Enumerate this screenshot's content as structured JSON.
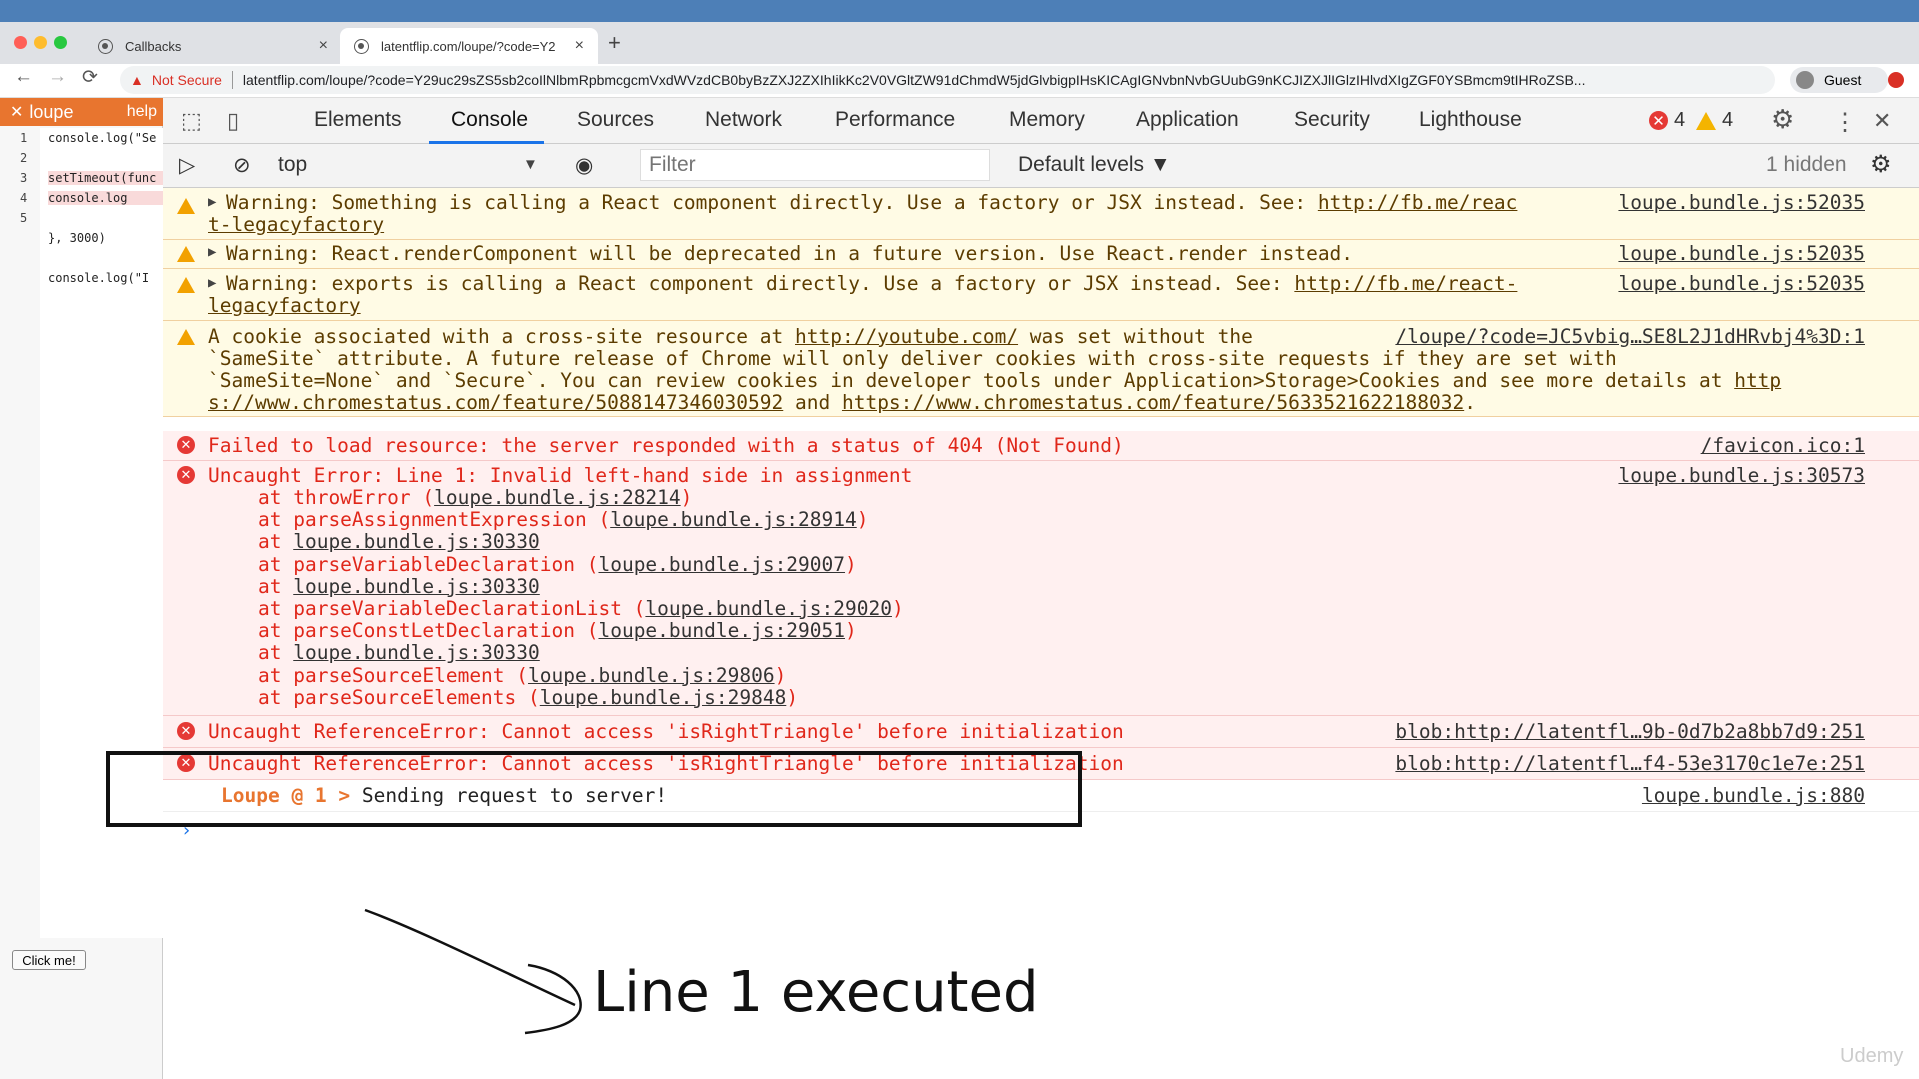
{
  "browser": {
    "tabs": [
      {
        "title": "Callbacks",
        "close": "×"
      },
      {
        "title": "latentflip.com/loupe/?code=Y2",
        "close": "×"
      }
    ],
    "new_tab": "+",
    "nav": {
      "back": "←",
      "forward": "→",
      "reload": "⟳"
    },
    "security_warning": "Not Secure",
    "url": "latentflip.com/loupe/?code=Y29uc29sZS5sb2coIlNlbmRpbmcgcmVxdWVzdCB0byBzZXJ2ZXIhIikKc2V0VGltZW91dChmdW5jdGlvbigpIHsKICAgIGNvbnNvbGUubG9nKCJIZXJlIGlzIHlvdXIgZGF0YSBmcm9tIHRoZSB...",
    "profile": "Guest"
  },
  "loupe": {
    "title": "loupe",
    "help": "help",
    "code_lines": [
      {
        "num": "1",
        "text": "console.log(\"Se"
      },
      {
        "num": "2",
        "text": ""
      },
      {
        "num": "3",
        "text": "setTimeout(func"
      },
      {
        "num": "4",
        "text": "    console.log"
      },
      {
        "num": "5",
        "text": ""
      },
      {
        "num": "",
        "text": "}, 3000)"
      },
      {
        "num": "",
        "text": ""
      },
      {
        "num": "",
        "text": "console.log(\"I"
      }
    ],
    "click_button": "Click me!"
  },
  "devtools": {
    "tabs": [
      "Elements",
      "Console",
      "Sources",
      "Network",
      "Performance",
      "Memory",
      "Application",
      "Security",
      "Lighthouse"
    ],
    "active_tab": "Console",
    "error_count": "4",
    "warning_count": "4",
    "close": "✕",
    "context": "top",
    "filter_placeholder": "Filter",
    "levels": "Default levels ▼",
    "hidden": "1 hidden"
  },
  "console": {
    "messages": [
      {
        "type": "warning",
        "line1": "Warning: Something is calling a React component directly. Use a factory or JSX instead. See: ",
        "link1": "http://fb.me/reac",
        "line2": "t-legacyfactory",
        "source": "loupe.bundle.js:52035"
      },
      {
        "type": "warning",
        "line1": "Warning: React.renderComponent will be deprecated in a future version. Use React.render instead.",
        "source": "loupe.bundle.js:52035"
      },
      {
        "type": "warning",
        "line1": "Warning: exports is calling a React component directly. Use a factory or JSX instead. See: ",
        "link1": "http://fb.me/react-",
        "line2": "legacyfactory",
        "source": "loupe.bundle.js:52035"
      },
      {
        "type": "warning",
        "line1a": "A cookie associated with a cross-site resource at ",
        "link1": "http://youtube.com/",
        "line1b": " was set without the",
        "line2": "`SameSite` attribute. A future release of Chrome will only deliver cookies with cross-site requests if they are set with",
        "line3a": "`SameSite=None` and `Secure`. You can review cookies in developer tools under Application>Storage>Cookies and see more details at ",
        "link3": "http",
        "line4a": "s://www.chromestatus.com/feature/5088147346030592",
        "line4b": " and ",
        "line4c": "https://www.chromestatus.com/feature/5633521622188032",
        "line4d": ".",
        "source": "/loupe/?code=JC5vbig…SE8L2J1dHRvbj4%3D:1"
      },
      {
        "type": "error",
        "line1": "Failed to load resource: the server responded with a status of 404 (Not Found)",
        "source": "/favicon.ico:1"
      },
      {
        "type": "error",
        "line1": "Uncaught Error: Line 1: Invalid left-hand side in assignment",
        "source": "loupe.bundle.js:30573",
        "stack": [
          {
            "fn": "at throwError (",
            "loc": "loupe.bundle.js:28214",
            "end": ")"
          },
          {
            "fn": "at parseAssignmentExpression (",
            "loc": "loupe.bundle.js:28914",
            "end": ")"
          },
          {
            "fn": "at ",
            "loc": "loupe.bundle.js:30330",
            "end": ""
          },
          {
            "fn": "at parseVariableDeclaration (",
            "loc": "loupe.bundle.js:29007",
            "end": ")"
          },
          {
            "fn": "at ",
            "loc": "loupe.bundle.js:30330",
            "end": ""
          },
          {
            "fn": "at parseVariableDeclarationList (",
            "loc": "loupe.bundle.js:29020",
            "end": ")"
          },
          {
            "fn": "at parseConstLetDeclaration (",
            "loc": "loupe.bundle.js:29051",
            "end": ")"
          },
          {
            "fn": "at ",
            "loc": "loupe.bundle.js:30330",
            "end": ""
          },
          {
            "fn": "at parseSourceElement (",
            "loc": "loupe.bundle.js:29806",
            "end": ")"
          },
          {
            "fn": "at parseSourceElements (",
            "loc": "loupe.bundle.js:29848",
            "end": ")"
          }
        ]
      },
      {
        "type": "error",
        "line1": "Uncaught ReferenceError: Cannot access 'isRightTriangle' before initialization",
        "source": "blob:http://latentfl…9b-0d7b2a8bb7d9:251"
      },
      {
        "type": "error",
        "line1": "Uncaught ReferenceError: Cannot access 'isRightTriangle' before initialization",
        "source": "blob:http://latentfl…f4-53e3170c1e7e:251"
      },
      {
        "type": "log",
        "prefix": "Loupe @ 1 >",
        "line1": " Sending request to server!",
        "source": "loupe.bundle.js:880"
      }
    ],
    "prompt": "›"
  },
  "annotation": {
    "text": "Line 1 executed"
  },
  "watermark": "Udemy",
  "colors": {
    "accent": "#1a73e8",
    "error": "#e0271a",
    "warning_bg": "#fffbe5",
    "error_bg": "#fff0f0",
    "loupe_orange": "#e8752f"
  }
}
